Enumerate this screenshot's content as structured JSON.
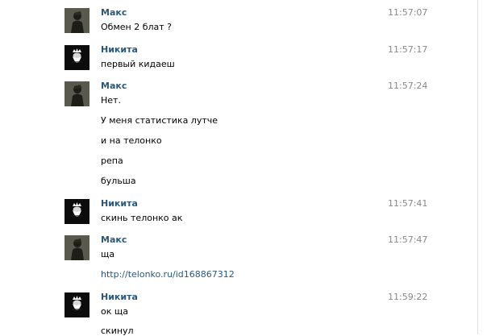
{
  "messages": [
    {
      "author": "Макс",
      "avatar": "dark-silhouette-avatar",
      "time": "11:57:07",
      "lines": [
        "Обмен 2 блат ?"
      ]
    },
    {
      "author": "Никита",
      "avatar": "bearded-king-logo-avatar",
      "time": "11:57:17",
      "lines": [
        "первый кидаеш"
      ]
    },
    {
      "author": "Макс",
      "avatar": "dark-silhouette-avatar",
      "time": "11:57:24",
      "lines": [
        "Нет.",
        "У меня статистика лутче",
        "и на телонко",
        "репа",
        "бульша"
      ]
    },
    {
      "author": "Никита",
      "avatar": "bearded-king-logo-avatar",
      "time": "11:57:41",
      "lines": [
        "скинь телонко ак"
      ]
    },
    {
      "author": "Макс",
      "avatar": "dark-silhouette-avatar",
      "time": "11:57:47",
      "lines": [
        "ща",
        "http://telonko.ru/id168867312"
      ]
    },
    {
      "author": "Никита",
      "avatar": "bearded-king-logo-avatar",
      "time": "11:59:22",
      "lines": [
        "ок ща",
        "скинул"
      ]
    }
  ],
  "colors": {
    "author": "#2b587a",
    "link": "#2b587a",
    "time": "#888888",
    "text": "#000000"
  }
}
